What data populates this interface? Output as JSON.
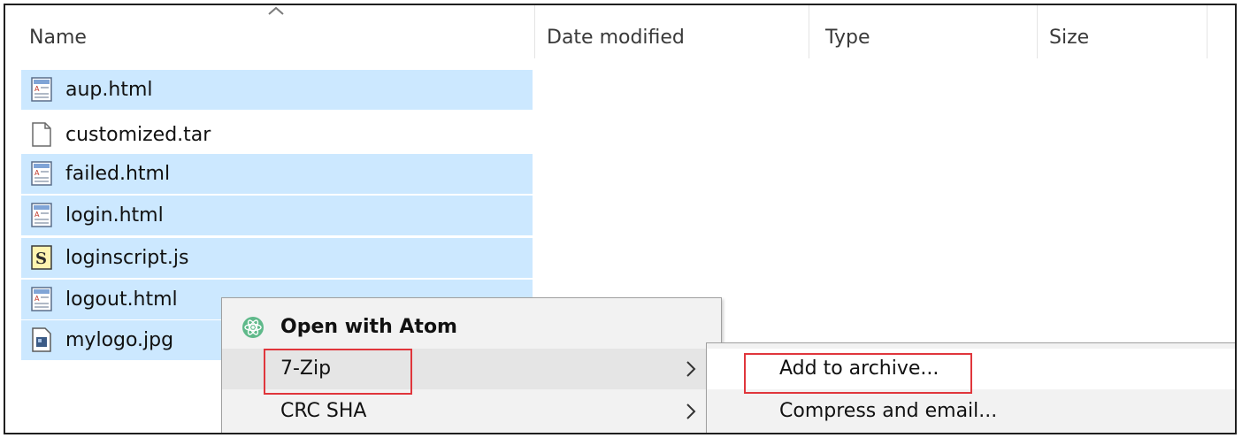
{
  "columns": {
    "name": "Name",
    "date_modified": "Date modified",
    "type": "Type",
    "size": "Size"
  },
  "files": [
    {
      "name": "aup.html",
      "icon": "html-file-icon",
      "selected": true
    },
    {
      "name": "customized.tar",
      "icon": "blank-file-icon",
      "selected": false
    },
    {
      "name": "failed.html",
      "icon": "html-file-icon",
      "selected": true
    },
    {
      "name": "login.html",
      "icon": "html-file-icon",
      "selected": true
    },
    {
      "name": "loginscript.js",
      "icon": "script-file-icon",
      "selected": true
    },
    {
      "name": "logout.html",
      "icon": "html-file-icon",
      "selected": true
    },
    {
      "name": "mylogo.jpg",
      "icon": "image-file-icon",
      "selected": true
    }
  ],
  "context_menu": {
    "items": [
      {
        "label": "Open with Atom",
        "icon": "atom-icon",
        "bold": true
      },
      {
        "label": "7-Zip",
        "has_submenu": true,
        "highlighted": true
      },
      {
        "label": "CRC SHA",
        "has_submenu": true
      }
    ]
  },
  "submenu": {
    "items": [
      {
        "label": "Add to archive...",
        "highlighted": true
      },
      {
        "label": "Compress and email..."
      }
    ]
  },
  "colors": {
    "selection": "#cce8ff",
    "menu_bg": "#f2f2f2",
    "highlight_box": "#e0363c"
  }
}
